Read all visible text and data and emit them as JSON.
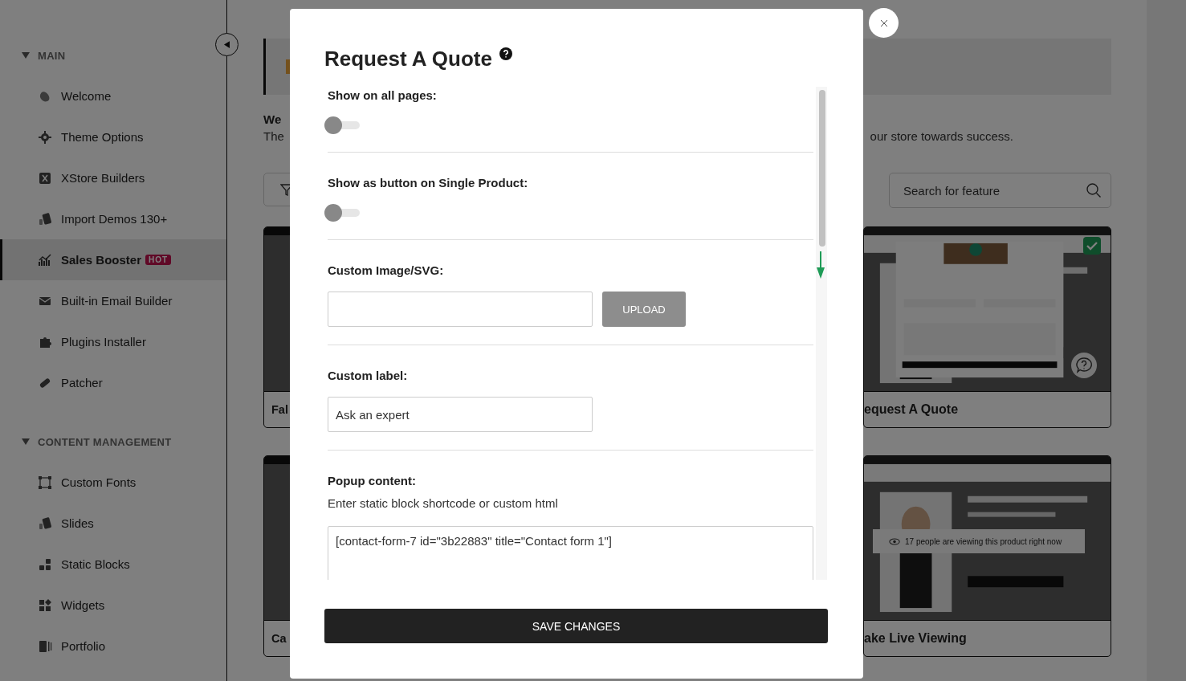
{
  "sidebar": {
    "sections": [
      {
        "title": "MAIN",
        "expanded": true,
        "items": [
          {
            "label": "Welcome",
            "selected": false
          },
          {
            "label": "Theme Options",
            "selected": false
          },
          {
            "label": "XStore Builders",
            "selected": false
          },
          {
            "label": "Import Demos 130+",
            "selected": false
          },
          {
            "label": "Sales Booster",
            "badge": "HOT",
            "selected": true
          },
          {
            "label": "Built-in Email Builder",
            "selected": false
          },
          {
            "label": "Plugins Installer",
            "selected": false
          },
          {
            "label": "Patcher",
            "selected": false
          }
        ]
      },
      {
        "title": "CONTENT MANAGEMENT",
        "expanded": true,
        "items": [
          {
            "label": "Custom Fonts",
            "selected": false
          },
          {
            "label": "Slides",
            "selected": false
          },
          {
            "label": "Static Blocks",
            "selected": false
          },
          {
            "label": "Widgets",
            "selected": false
          },
          {
            "label": "Portfolio",
            "selected": false
          }
        ]
      }
    ]
  },
  "page": {
    "intro_heading": "We",
    "intro_text": "The",
    "intro_tail": "our store towards success.",
    "search": {
      "placeholder": "Search for feature"
    },
    "card_rows": [
      {
        "left_title": "Fal",
        "right_title": "equest A Quote",
        "active": true
      },
      {
        "left_title": "Ca",
        "right_title": "ake Live Viewing",
        "active": false,
        "preview_caption": "17 people are viewing this product right now"
      }
    ]
  },
  "modal": {
    "title": "Request A Quote",
    "fields": [
      {
        "kind": "toggle",
        "label": "Show on all pages:",
        "on": false
      },
      {
        "kind": "toggle",
        "label": "Show as button on Single Product:",
        "on": false
      },
      {
        "kind": "upload",
        "label": "Custom Image/SVG:",
        "button": "UPLOAD"
      },
      {
        "kind": "text",
        "label": "Custom label:",
        "value": "Ask an expert"
      },
      {
        "kind": "textarea",
        "label": "Popup content:",
        "description": "Enter static block shortcode or custom html",
        "value": "[contact-form-7 id=\"3b22883\" title=\"Contact form 1\"]"
      }
    ],
    "save_button": "SAVE CHANGES"
  }
}
